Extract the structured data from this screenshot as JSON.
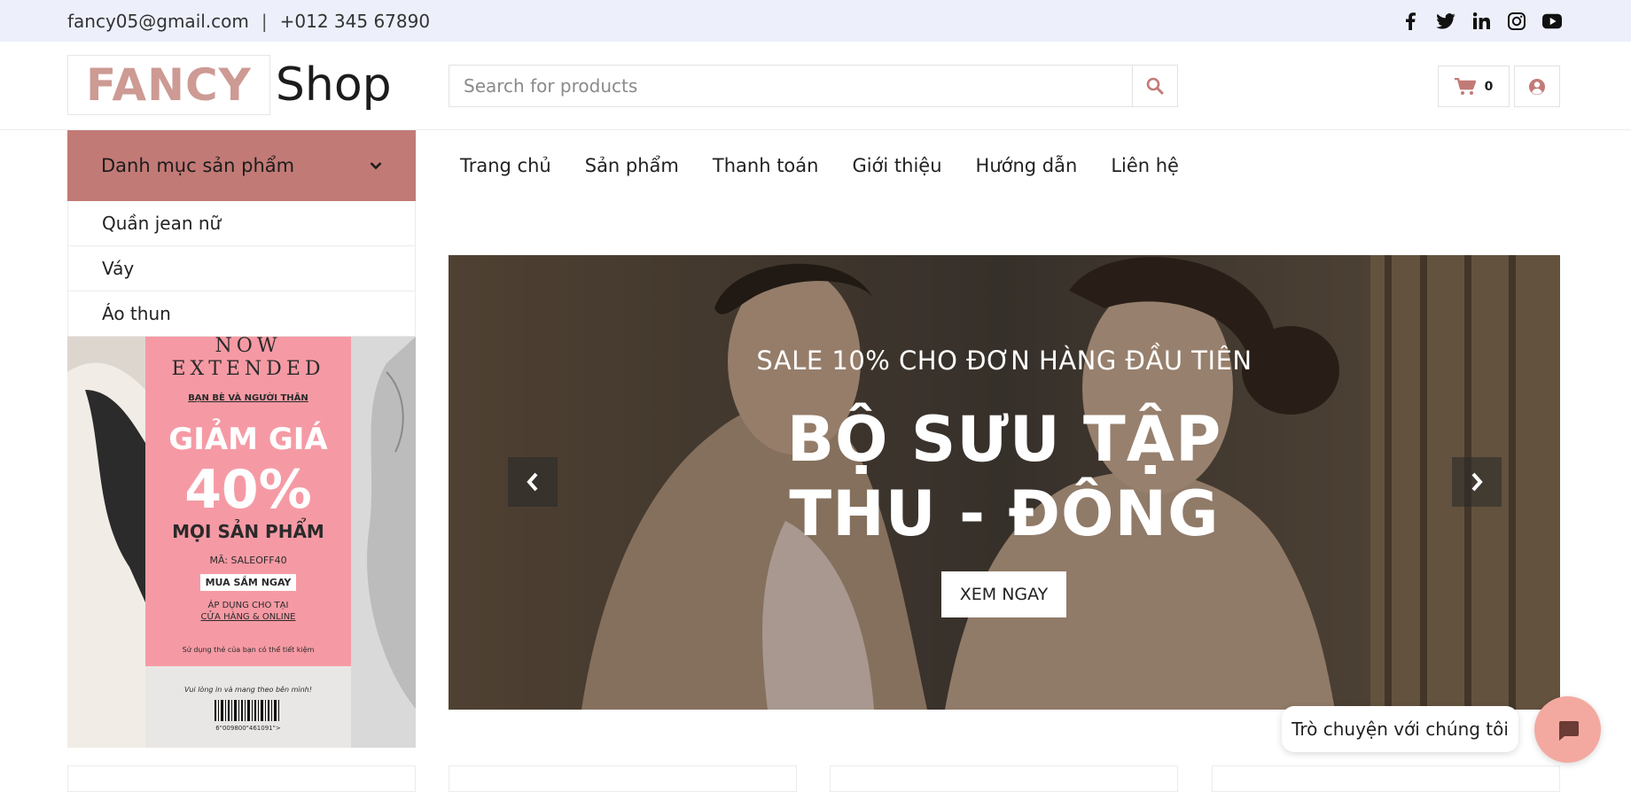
{
  "topbar": {
    "email": "fancy05@gmail.com",
    "separator": "|",
    "phone": "+012 345 67890",
    "social_icons": [
      "facebook-icon",
      "twitter-icon",
      "linkedin-icon",
      "instagram-icon",
      "youtube-icon"
    ]
  },
  "header": {
    "logo_highlight": "FANCY",
    "logo_word": "Shop",
    "search_placeholder": "Search for products",
    "cart_count": "0"
  },
  "categories": {
    "title": "Danh mục sản phẩm",
    "items": [
      "Quần jean nữ",
      "Váy",
      "Áo thun"
    ]
  },
  "promo": {
    "line1": "NOW",
    "line2": "EXTENDED",
    "line3": "BẠN BÈ VÀ NGƯỜI THÂN",
    "line4": "GIẢM GIÁ",
    "line5": "40%",
    "line6": "MỌI SẢN PHẨM",
    "line7": "MÃ: SALEOFF40",
    "line8": "MUA SẮM NGAY",
    "line9": "ÁP DỤNG CHO TẠI",
    "line10": "CỬA HÀNG & ONLINE",
    "line11": "Sử dụng thẻ của bạn có thể tiết kiệm",
    "line12": "Vui lòng in và mang theo bên mình!",
    "barcode": "6\"009800\"461091\">"
  },
  "nav": {
    "items": [
      "Trang chủ",
      "Sản phẩm",
      "Thanh toán",
      "Giới thiệu",
      "Hướng dẫn",
      "Liên hệ"
    ]
  },
  "hero": {
    "subtitle": "SALE 10% CHO ĐƠN HÀNG ĐẦU TIÊN",
    "title": "BỘ SƯU TẬP THU - ĐÔNG",
    "cta": "XEM NGAY"
  },
  "chat": {
    "label": "Trò chuyện với chúng tôi"
  },
  "colors": {
    "accent": "#c27a76",
    "logo_pink": "#cd9a94",
    "topbar_bg": "#edf0fb",
    "chat_button": "#f3a9a0"
  }
}
